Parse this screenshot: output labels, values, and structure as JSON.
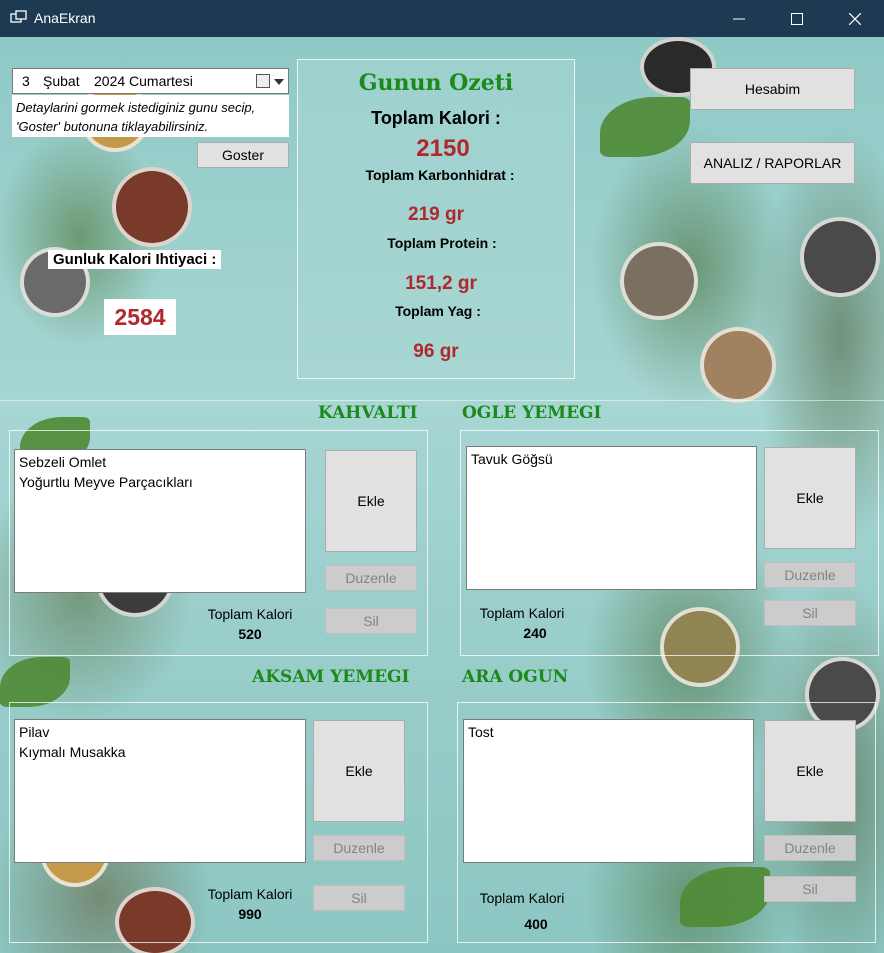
{
  "window": {
    "title": "AnaEkran"
  },
  "date": {
    "day": "3",
    "month": "Şubat",
    "year_weekday": "2024 Cumartesi",
    "hint": "Detaylarini gormek istediginiz gunu secip, 'Goster' butonuna tiklayabilirsiniz.",
    "show_button": "Goster"
  },
  "daily_need": {
    "label": "Gunluk Kalori Ihtiyaci :",
    "value": "2584"
  },
  "summary": {
    "title": "Gunun Ozeti",
    "calorie_label": "Toplam Kalori :",
    "calorie_value": "2150",
    "carb_label": "Toplam Karbonhidrat :",
    "carb_value": "219 gr",
    "protein_label": "Toplam Protein :",
    "protein_value": "151,2 gr",
    "fat_label": "Toplam Yag :",
    "fat_value": "96 gr"
  },
  "nav": {
    "account_button": "Hesabim",
    "reports_button": "ANALIZ / RAPORLAR"
  },
  "meals": {
    "breakfast": {
      "title": "KAHVALTI",
      "items": [
        "Sebzeli Omlet",
        "Yoğurtlu Meyve Parçacıkları"
      ],
      "total_label": "Toplam Kalori",
      "total": "520",
      "add": "Ekle",
      "edit": "Duzenle",
      "delete": "Sil"
    },
    "lunch": {
      "title": "OGLE YEMEGI",
      "items": [
        "Tavuk Göğsü"
      ],
      "total_label": "Toplam Kalori",
      "total": "240",
      "add": "Ekle",
      "edit": "Duzenle",
      "delete": "Sil"
    },
    "dinner": {
      "title": "AKSAM YEMEGI",
      "items": [
        "Pilav",
        "Kıymalı Musakka"
      ],
      "total_label": "Toplam Kalori",
      "total": "990",
      "add": "Ekle",
      "edit": "Duzenle",
      "delete": "Sil"
    },
    "snack": {
      "title": "ARA OGUN",
      "items": [
        "Tost"
      ],
      "total_label": "Toplam Kalori",
      "total": "400",
      "add": "Ekle",
      "edit": "Duzenle",
      "delete": "Sil"
    }
  },
  "colors": {
    "titlebar": "#1e3a52",
    "heading_green": "#1b8a1b",
    "value_red": "#b0282d"
  }
}
